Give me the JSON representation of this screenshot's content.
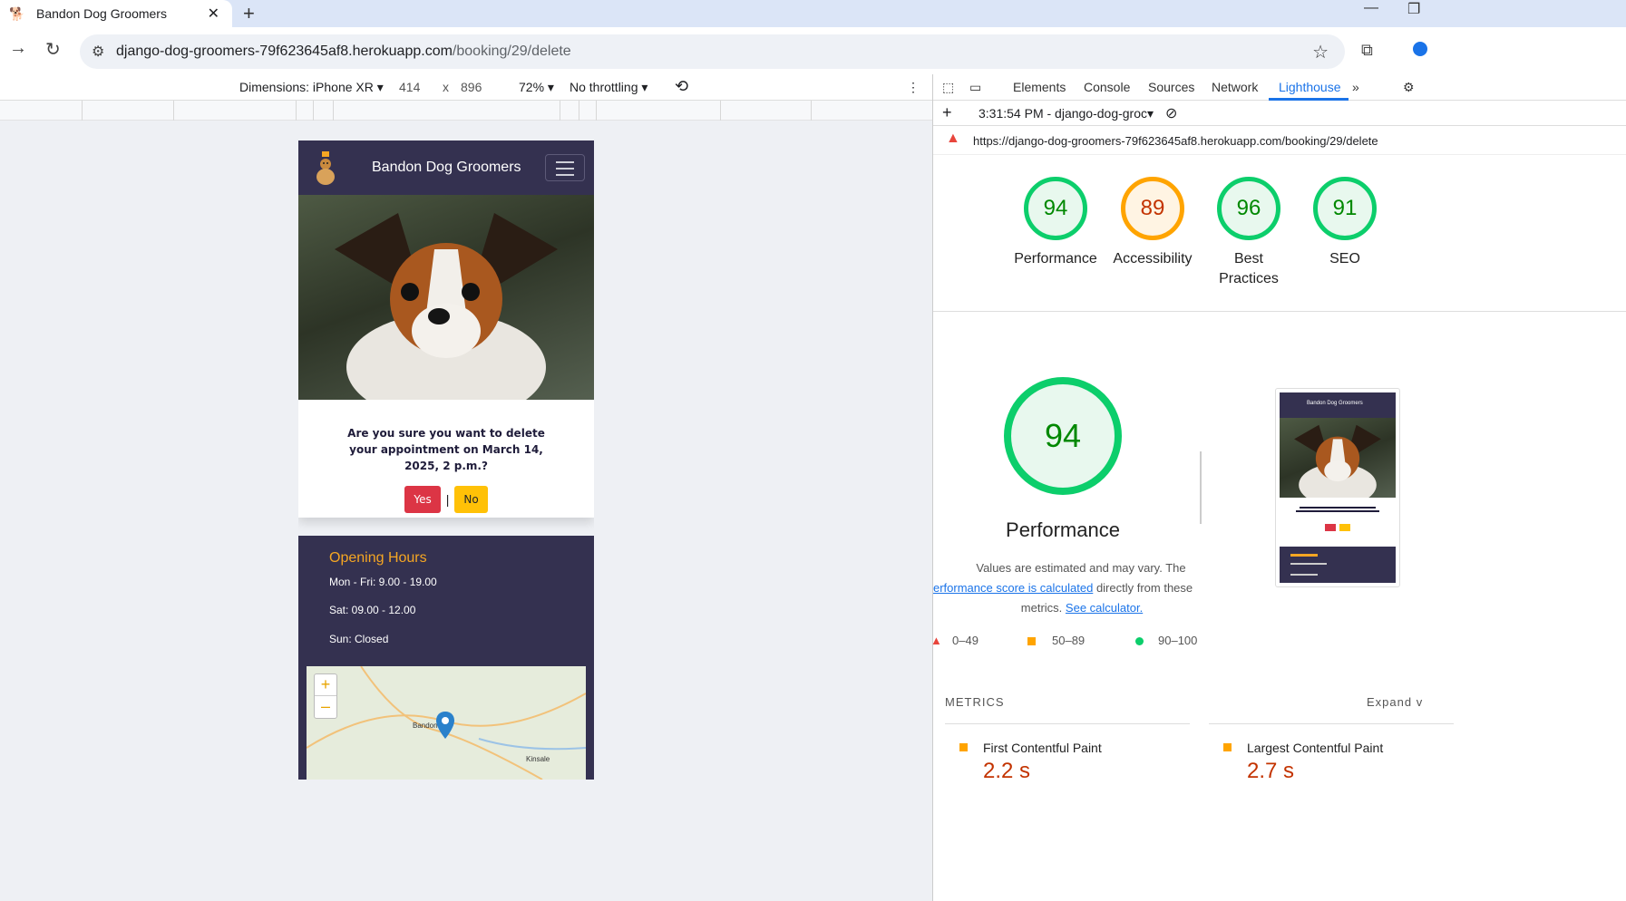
{
  "browser": {
    "tab_title": "Bandon Dog Groomers",
    "url_host": "django-dog-groomers-79f623645af8.herokuapp.com",
    "url_path": "/booking/29/delete"
  },
  "emulation": {
    "device": "Dimensions: iPhone XR",
    "width": "414",
    "times": "x",
    "height": "896",
    "zoom": "72%",
    "throttling": "No throttling"
  },
  "site": {
    "brand": "Bandon Dog Groomers",
    "confirm_text": "Are you sure you want to delete your appointment on March 14, 2025, 2 p.m.?",
    "yes_label": "Yes",
    "separator": "|",
    "no_label": "No",
    "footer_title": "Opening Hours",
    "hours": [
      "Mon - Fri: 9.00 - 19.00",
      "Sat: 09.00 - 12.00",
      "Sun: Closed"
    ],
    "map_labels": [
      "Bandon",
      "Kinsale"
    ],
    "zoom_in": "+",
    "zoom_out": "–"
  },
  "devtools": {
    "tabs": [
      "Elements",
      "Console",
      "Sources",
      "Network",
      "Lighthouse"
    ],
    "active_tab": "Lighthouse",
    "report_selector": "3:31:54 PM - django-dog-groc",
    "report_url": "https://django-dog-groomers-79f623645af8.herokuapp.com/booking/29/delete",
    "scores": [
      {
        "value": "94",
        "label": "Performance"
      },
      {
        "value": "89",
        "label": "Accessibility"
      },
      {
        "value": "96",
        "label": "Best Practices"
      },
      {
        "value": "91",
        "label": "SEO"
      }
    ],
    "perf_score": "94",
    "perf_title": "Performance",
    "perf_desc_1": "Values are estimated and may vary. The",
    "perf_link": "erformance score is calculated",
    "perf_desc_2": "directly from these",
    "perf_desc_3": "metrics.",
    "perf_calc_link": "See calculator.",
    "legend": [
      "0–49",
      "50–89",
      "90–100"
    ],
    "metrics_label": "METRICS",
    "expand_label": "Expand v",
    "metrics": [
      {
        "name": "First Contentful Paint",
        "value": "2.2 s"
      },
      {
        "name": "Largest Contentful Paint",
        "value": "2.7 s"
      }
    ]
  },
  "colors": {
    "nav": "#343150",
    "accent_orange": "#f5a623",
    "score_green": "#0cce6b",
    "score_orange": "#ffa400",
    "danger": "#dc3545",
    "warning": "#ffc107"
  }
}
